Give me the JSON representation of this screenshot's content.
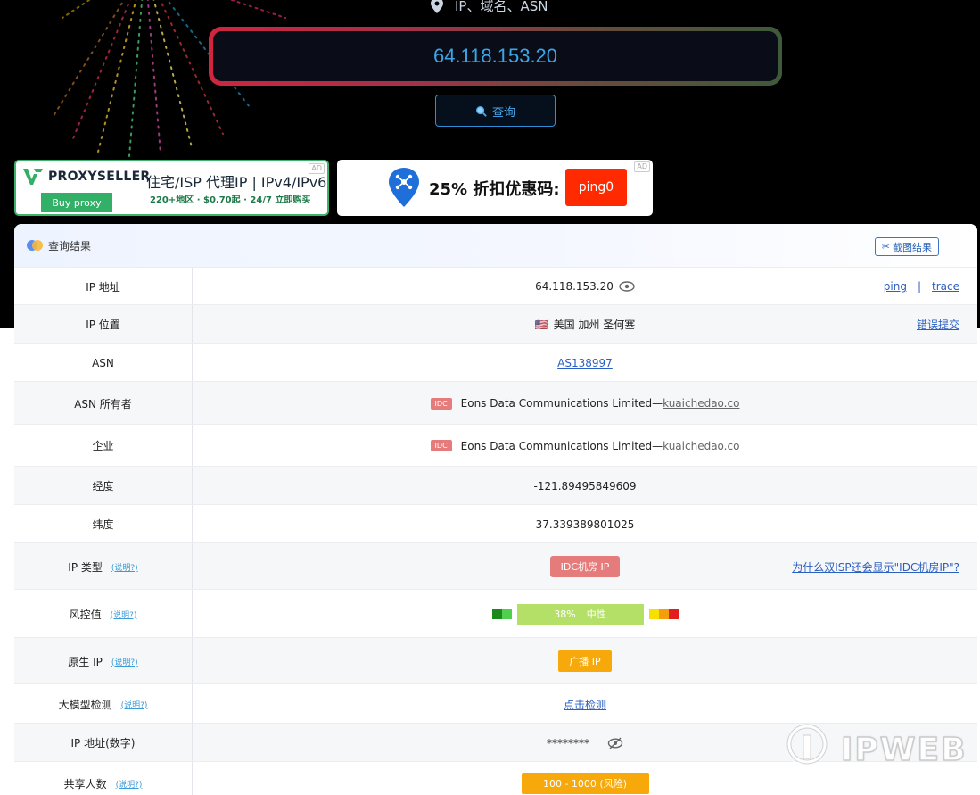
{
  "hero": {
    "hint": "IP、域名、ASN",
    "search_value": "64.118.153.20",
    "query_label": "查询"
  },
  "ads": {
    "proxyseller": {
      "brand": "PROXYSELLER",
      "buy": "Buy proxy",
      "title": "住宅/ISP 代理IP | IPv4/IPv6",
      "subtitle": "220+地区 · $0.70起 · 24/7 立即购买"
    },
    "promo": {
      "text": "25% 折扣优惠码:",
      "code": "ping0"
    }
  },
  "panel": {
    "title": "查询结果",
    "screenshot_label": "截图结果"
  },
  "rows": {
    "ip": {
      "label": "IP 地址",
      "value": "64.118.153.20",
      "ping": "ping",
      "sep": "|",
      "trace": "trace"
    },
    "location": {
      "label": "IP 位置",
      "flag": "🇺🇸",
      "value": "美国 加州 圣何塞",
      "report": "错误提交"
    },
    "asn": {
      "label": "ASN",
      "value": "AS138997"
    },
    "asn_owner": {
      "label": "ASN 所有者",
      "badge": "IDC",
      "value": "Eons Data Communications Limited— ",
      "domain": "kuaichedao.co"
    },
    "org": {
      "label": "企业",
      "badge": "IDC",
      "value": "Eons Data Communications Limited— ",
      "domain": "kuaichedao.co"
    },
    "longitude": {
      "label": "经度",
      "value": "-121.89495849609"
    },
    "latitude": {
      "label": "纬度",
      "value": "37.339389801025"
    },
    "ip_type": {
      "label": "IP 类型",
      "explain": "(说明?)",
      "value": "IDC机房 IP",
      "link": "为什么双ISP还会显示\"IDC机房IP\"?"
    },
    "risk": {
      "label": "风控值",
      "explain": "(说明?)",
      "percent": "38%",
      "level": "中性"
    },
    "native": {
      "label": "原生 IP",
      "explain": "(说明?)",
      "value": "广播 IP"
    },
    "llm": {
      "label": "大模型检测",
      "explain": "(说明?)",
      "value": "点击检测"
    },
    "ip_num": {
      "label": "IP 地址(数字)",
      "value": "********"
    },
    "shared": {
      "label": "共享人数",
      "explain": "(说明?)",
      "value": "100 - 1000 (风险)"
    }
  },
  "watermark": "IPWEB",
  "colors": {
    "risk_low_1": "#1a8a1a",
    "risk_low_2": "#4fd04f",
    "risk_mid": "#b5e068",
    "risk_high_1": "#f7e000",
    "risk_high_2": "#f59e0b",
    "risk_high_3": "#e11d1d"
  }
}
